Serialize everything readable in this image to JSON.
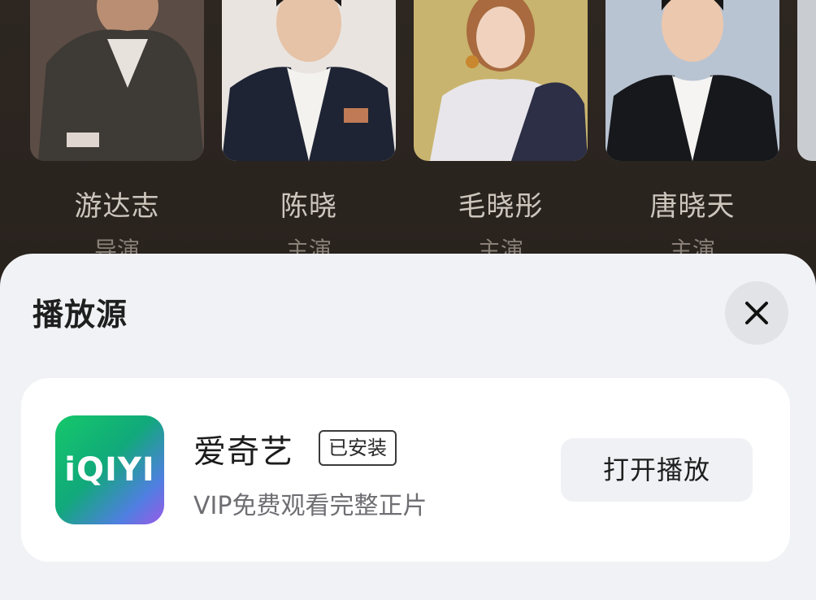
{
  "cast": [
    {
      "name": "游达志",
      "role": "导演"
    },
    {
      "name": "陈晓",
      "role": "主演"
    },
    {
      "name": "毛晓彤",
      "role": "主演"
    },
    {
      "name": "唐晓天",
      "role": "主演"
    }
  ],
  "sheet": {
    "title": "播放源",
    "close_icon": "close-icon"
  },
  "source": {
    "logo_text": "iQIYI",
    "app_name": "爱奇艺",
    "badge": "已安装",
    "description": "VIP免费观看完整正片",
    "open_label": "打开播放"
  },
  "colors": {
    "sheet_bg": "#f1f2f5",
    "card_bg": "#ffffff",
    "logo_gradient": [
      "#15c86a",
      "#4f7fe0",
      "#9a5ae8"
    ]
  }
}
